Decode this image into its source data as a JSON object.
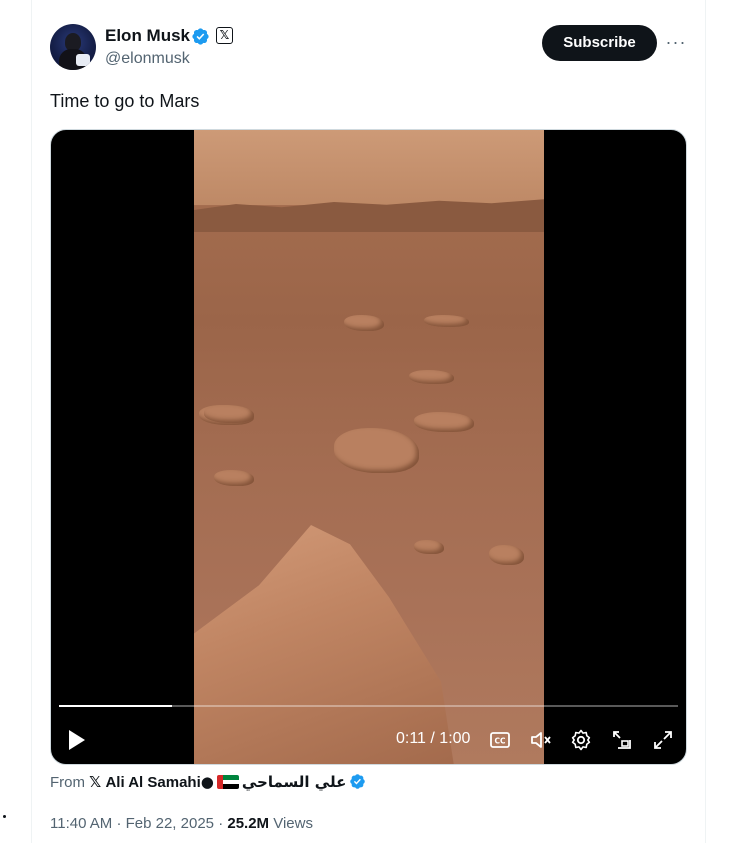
{
  "author": {
    "name": "Elon Musk",
    "handle": "@elonmusk",
    "affiliate_badge": "𝕏"
  },
  "subscribe_label": "Subscribe",
  "more_label": "···",
  "tweet_text": "Time to go to Mars",
  "video": {
    "time": "0:11 / 1:00",
    "progress": 0.183,
    "controls": [
      "play-icon",
      "captions-icon",
      "mute-icon",
      "settings-icon",
      "pip-icon",
      "fullscreen-icon"
    ]
  },
  "source": {
    "prefix": "From",
    "x_glyph": "𝕏",
    "name": "Ali Al Samahi",
    "arabic_name": "علي السماحي"
  },
  "meta": {
    "time": "11:40 AM",
    "sep1": "·",
    "date": "Feb 22, 2025",
    "sep2": "·",
    "views_count": "25.2M",
    "views_label": "Views"
  },
  "colors": {
    "verified_blue": "#1d9bf0",
    "text_primary": "#0f1419",
    "text_secondary": "#536471"
  }
}
